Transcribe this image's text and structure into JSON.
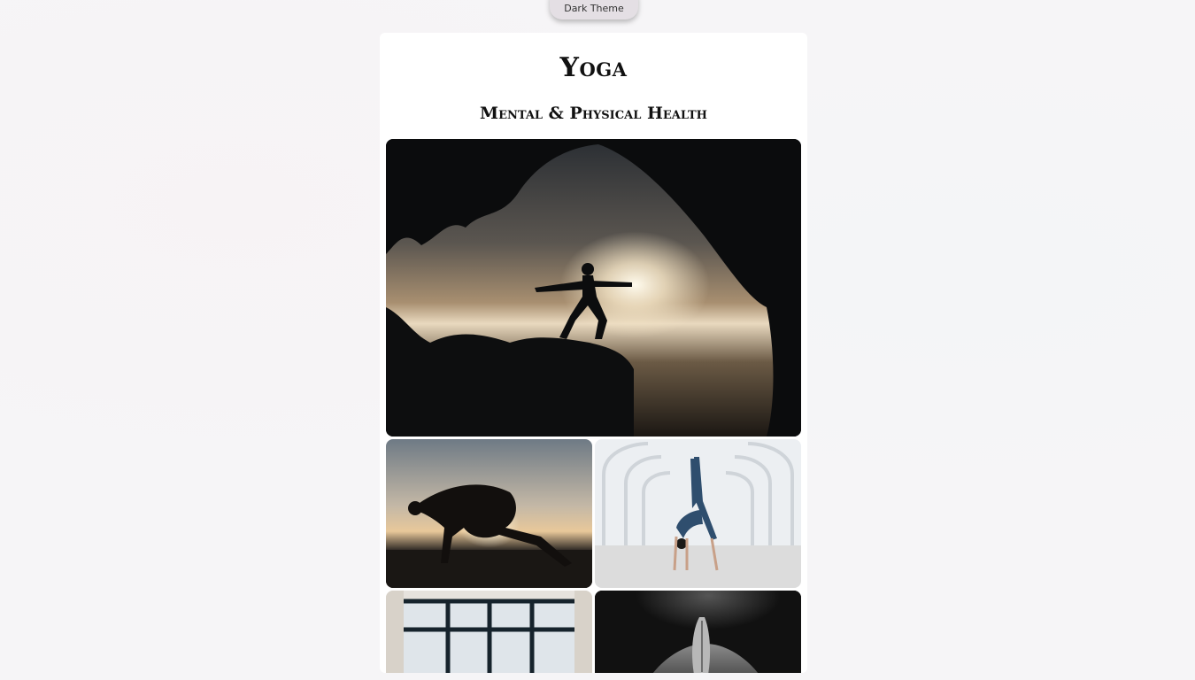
{
  "theme_toggle": {
    "label": "Dark Theme"
  },
  "card": {
    "title": "Yoga",
    "subtitle": "Mental & Physical Health"
  },
  "gallery": {
    "photos": [
      {
        "name": "warrior-pose-cave-sunset-photo"
      },
      {
        "name": "beach-sunset-pose-photo"
      },
      {
        "name": "white-archway-backbend-photo"
      },
      {
        "name": "window-frame-photo"
      },
      {
        "name": "praying-hands-back-photo"
      }
    ]
  }
}
